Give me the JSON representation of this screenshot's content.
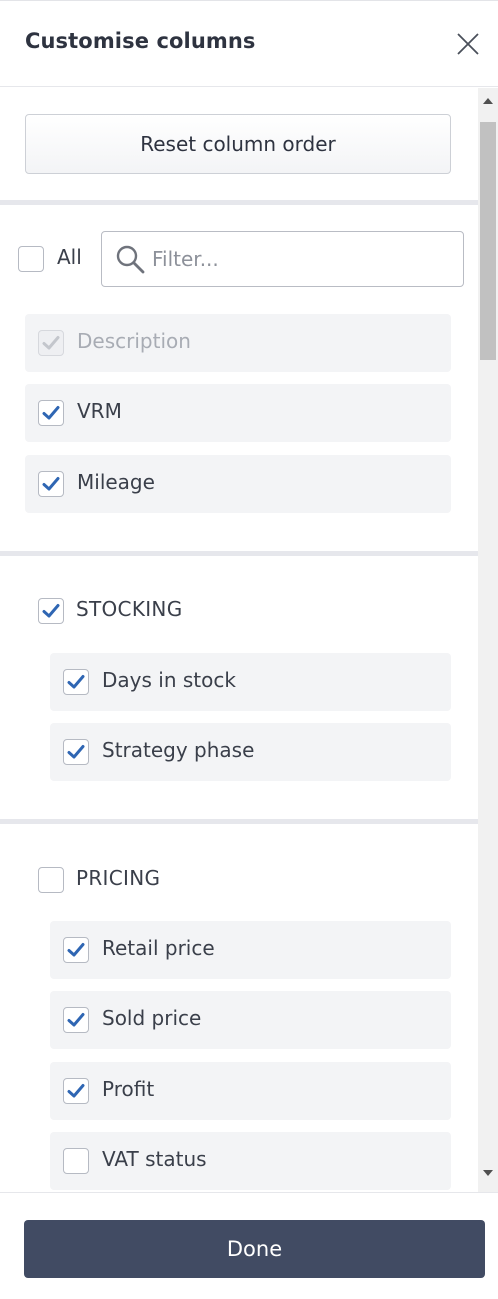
{
  "header": {
    "title": "Customise columns",
    "close_icon": "close-icon"
  },
  "reset_button": {
    "label": "Reset column order"
  },
  "filter": {
    "all_label": "All",
    "all_checked": false,
    "placeholder": "Filter...",
    "value": ""
  },
  "base_columns": [
    {
      "label": "Description",
      "checked": true,
      "disabled": true
    },
    {
      "label": "VRM",
      "checked": true,
      "disabled": false
    },
    {
      "label": "Mileage",
      "checked": true,
      "disabled": false
    }
  ],
  "groups": [
    {
      "name": "STOCKING",
      "checked": true,
      "items": [
        {
          "label": "Days in stock",
          "checked": true
        },
        {
          "label": "Strategy phase",
          "checked": true
        }
      ]
    },
    {
      "name": "PRICING",
      "checked": false,
      "items": [
        {
          "label": "Retail price",
          "checked": true
        },
        {
          "label": "Sold price",
          "checked": true
        },
        {
          "label": "Profit",
          "checked": true
        },
        {
          "label": "VAT status",
          "checked": false
        }
      ]
    }
  ],
  "footer": {
    "done_label": "Done"
  },
  "colors": {
    "check": "#2f66b3",
    "check_disabled": "#c3c6cc",
    "primary": "#414b63",
    "item_bg": "#f3f4f6"
  }
}
